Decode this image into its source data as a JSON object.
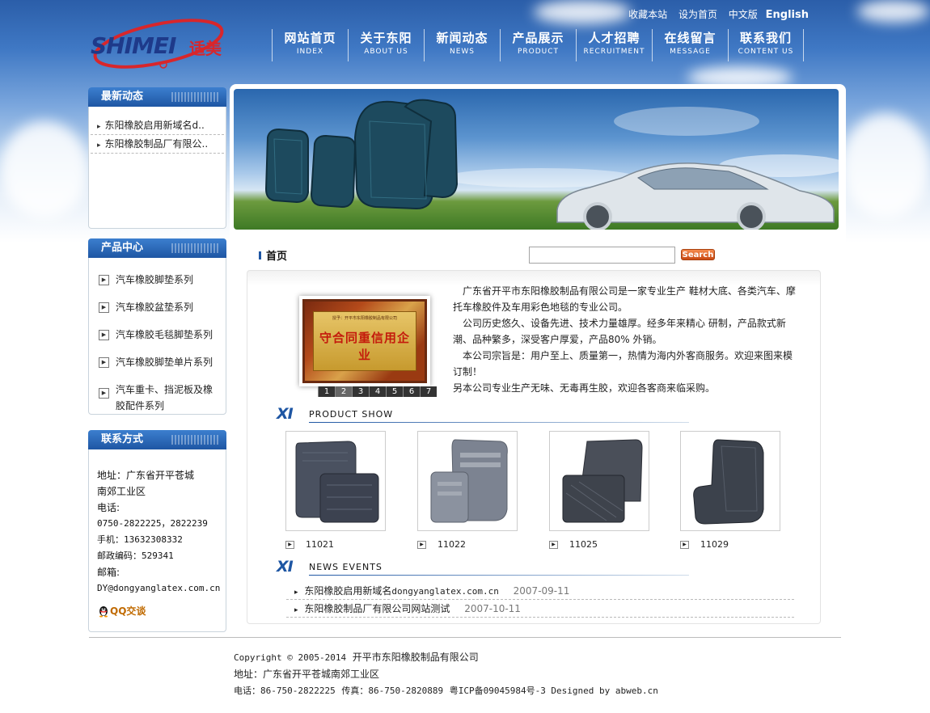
{
  "header": {
    "top_links": [
      "收藏本站",
      "设为首页",
      "中文版"
    ],
    "english_link": "English",
    "logo_text": "SHIMEI",
    "logo_cn": "适美",
    "nav": [
      {
        "cn": "网站首页",
        "en": "INDEX"
      },
      {
        "cn": "关于东阳",
        "en": "ABOUT US"
      },
      {
        "cn": "新闻动态",
        "en": "NEWS"
      },
      {
        "cn": "产品展示",
        "en": "PRODUCT"
      },
      {
        "cn": "人才招聘",
        "en": "RECRUITMENT"
      },
      {
        "cn": "在线留言",
        "en": "MESSAGE"
      },
      {
        "cn": "联系我们",
        "en": "CONTENT US"
      }
    ]
  },
  "sidebar": {
    "latest_title": "最新动态",
    "latest_items": [
      "东阳橡胶启用新域名d..",
      "东阳橡胶制品厂有限公.."
    ],
    "products_title": "产品中心",
    "product_items": [
      "汽车橡胶脚垫系列",
      "汽车橡胶盆垫系列",
      "汽车橡胶毛毯脚垫系列",
      "汽车橡胶脚垫单片系列",
      "汽车重卡、挡泥板及橡胶配件系列"
    ],
    "contact_title": "联系方式",
    "contact": {
      "address_label": "地址：广东省开平苍城",
      "address_line2": "南郊工业区",
      "phone_label": "电话:",
      "phone": "0750-2822225，2822239",
      "mobile": "手机：13632308332",
      "postcode": "邮政编码：529341",
      "email_label": "邮箱:",
      "email": "DY@dongyanglatex.com.cn",
      "qq": "QQ交谈"
    }
  },
  "main": {
    "breadcrumb": "首页",
    "search_placeholder": "",
    "search_button": "Search",
    "cert_small": "授予：开平市东阳橡胶制品有限公司",
    "cert_text": "守合同重信用企业",
    "pager": [
      "1",
      "2",
      "3",
      "4",
      "5",
      "6",
      "7"
    ],
    "pager_active": "2",
    "intro": [
      "广东省开平市东阳橡胶制品有限公司是一家专业生产 鞋材大底、各类汽车、摩托车橡胶件及车用彩色地毯的专业公司。",
      "公司历史悠久、设备先进、技术力量雄厚。经多年来精心 研制，产品款式新潮、品种繁多，深受客户厚爱，产品80% 外销。",
      "本公司宗旨是：用户至上、质量第一，热情为海内外客商服务。欢迎来图来模订制！",
      "另本公司专业生产无味、无毒再生胶，欢迎各客商来临采购。"
    ],
    "product_show_xi": "XI",
    "product_show_label": "PRODUCT SHOW",
    "products": [
      "11021",
      "11022",
      "11025",
      "11029"
    ],
    "news_xi": "XI",
    "news_label": "NEWS EVENTS",
    "news": [
      {
        "prefix": "东阳橡胶启用新域名",
        "domain": "dongyanglatex.com.cn",
        "date": "2007-09-11"
      },
      {
        "prefix": "东阳橡胶制品厂有限公司网站测试",
        "domain": "",
        "date": "2007-10-11"
      }
    ]
  },
  "footer": {
    "copyright_en": "Copyright © 2005-2014",
    "copyright_cn": "开平市东阳橡胶制品有限公司",
    "address": "地址：广东省开平苍城南郊工业区",
    "phone": "电话：86-750-2822225",
    "fax": "传真：86-750-2820889",
    "icp": "粤ICP备09045984号-3 Designed by abweb.cn"
  },
  "colors": {
    "brand_blue": "#1e56a3",
    "search_orange": "#e46a2a",
    "logo_red": "#d8262b"
  }
}
